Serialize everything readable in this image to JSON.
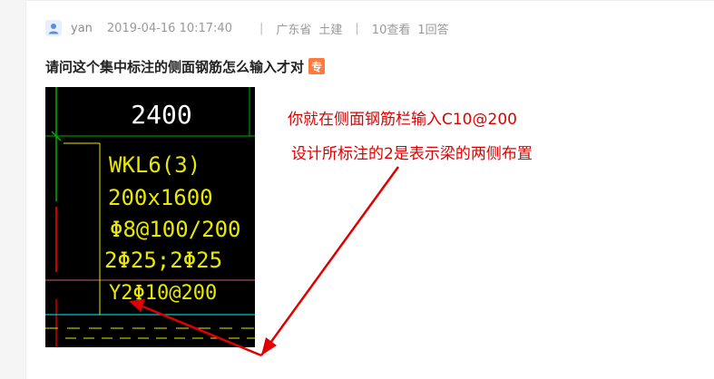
{
  "meta": {
    "username": "yan",
    "datetime": "2019-04-16 10:17:40",
    "sep": "|",
    "province": "广东省",
    "category": "土建",
    "views": "10查看",
    "answers": "1回答"
  },
  "question": {
    "title": "请问这个集中标注的侧面钢筋怎么输入才对",
    "badge": "专"
  },
  "drawing": {
    "dimension": "2400",
    "lines": [
      "WKL6(3)",
      "200x1600",
      "Φ8@100/200",
      "2Φ25;2Φ25",
      "Y2Φ10@200"
    ]
  },
  "annotations": {
    "line1": "你就在侧面钢筋栏输入C10@200",
    "line2": "设计所标注的2是表示梁的两侧布置"
  },
  "colors": {
    "cad_background": "#000000",
    "cad_text": "#e8e800",
    "cad_green": "#00b000",
    "cad_cyan": "#00c8c8",
    "cad_red": "#c80000",
    "annotation": "#e00000",
    "badge": "#ff7a3d"
  }
}
